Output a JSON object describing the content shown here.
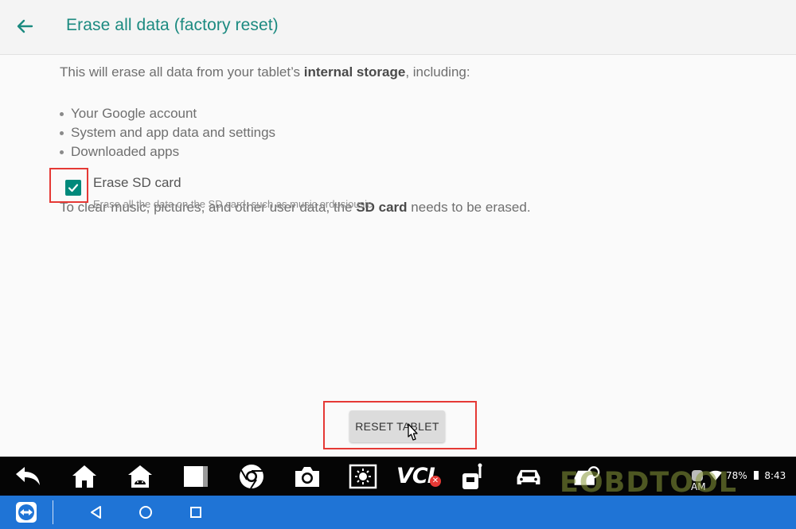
{
  "header": {
    "title": "Erase all data (factory reset)"
  },
  "content": {
    "intro_pre": "This will erase all data from your tablet’s ",
    "intro_bold": "internal storage",
    "intro_post": ", including:",
    "bullets": [
      "Your Google account",
      "System and app data and settings",
      "Downloaded apps"
    ],
    "sd_pre": "To clear music, pictures, and other user data, the ",
    "sd_bold": "SD card",
    "sd_post": " needs to be erased."
  },
  "erase_sd": {
    "checked": true,
    "label": "Erase SD card",
    "description": "Erase all the data on the SD card, such as music ordusiousic"
  },
  "reset_button": {
    "label": "RESET TABLET"
  },
  "taskbar": {
    "vci_label": "VCI",
    "vci_badge": "✕",
    "battery": "78%",
    "time": "8:43 AM",
    "icons": [
      "back-icon",
      "home-icon",
      "android-home-icon",
      "window-icon",
      "chrome-icon",
      "camera-icon",
      "brightness-icon",
      "vci-icon",
      "diagnostic-tool-icon",
      "car-icon",
      "car-service-icon"
    ]
  },
  "watermark": "EOBDTOOL",
  "colors": {
    "accent": "#1b8a80",
    "checkbox": "#00897b",
    "highlight": "#e53935",
    "navbar": "#1f74d6",
    "taskbar": "#050505"
  }
}
